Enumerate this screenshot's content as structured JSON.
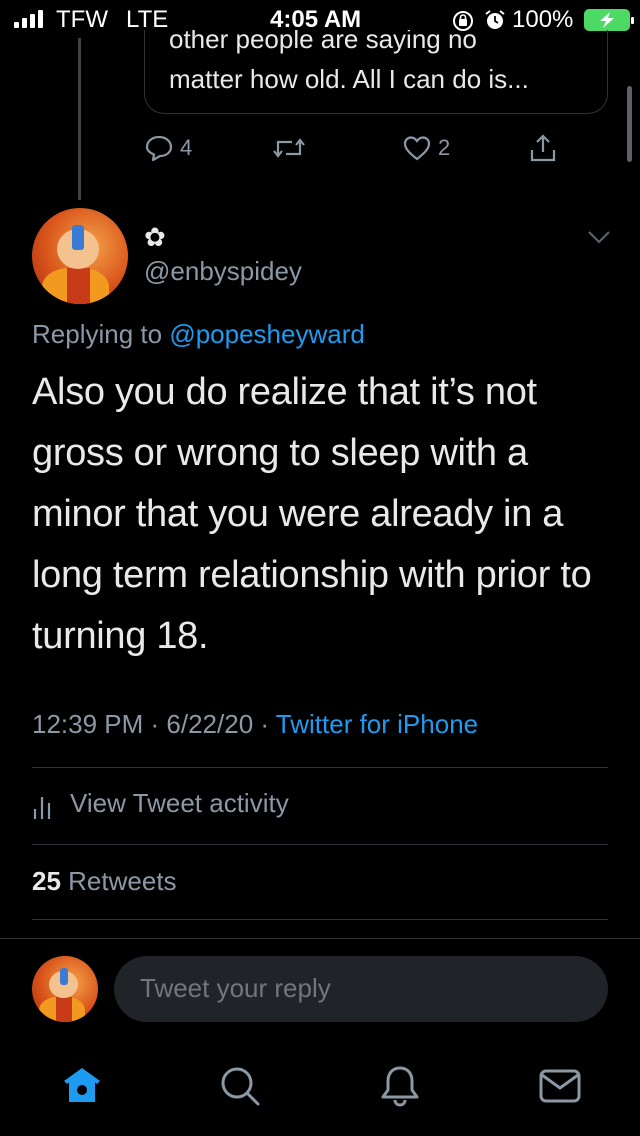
{
  "status_bar": {
    "carrier": "TFW",
    "network": "LTE",
    "time": "4:05 AM",
    "battery_percent": "100%",
    "battery_color": "#4cd964"
  },
  "quoted": {
    "line1": "other people are saying no",
    "line2": "matter how old. All I can do is...",
    "reply_count": "4",
    "like_count": "2"
  },
  "tweet": {
    "display_name": "✿",
    "handle": "@enbyspidey",
    "replying_prefix": "Replying to",
    "replying_mention": "@popesheyward",
    "text": "Also you do realize that it’s not gross or wrong to sleep with a minor that you were already in a long term relationship with prior to turning 18.",
    "time": "12:39 PM",
    "date": "6/22/20",
    "separator": " · ",
    "client": "Twitter for iPhone",
    "activity_label": "View Tweet activity",
    "retweet_count": "25",
    "retweet_label": "Retweets"
  },
  "reply_bar": {
    "placeholder": "Tweet your reply"
  },
  "tab_bar": {
    "icons": [
      "home-icon",
      "search-icon",
      "notifications-icon",
      "messages-icon"
    ],
    "active_color": "#1d9bf0"
  },
  "colors": {
    "background": "#000000",
    "link": "#1d9bf0",
    "muted": "#8b98a5"
  }
}
